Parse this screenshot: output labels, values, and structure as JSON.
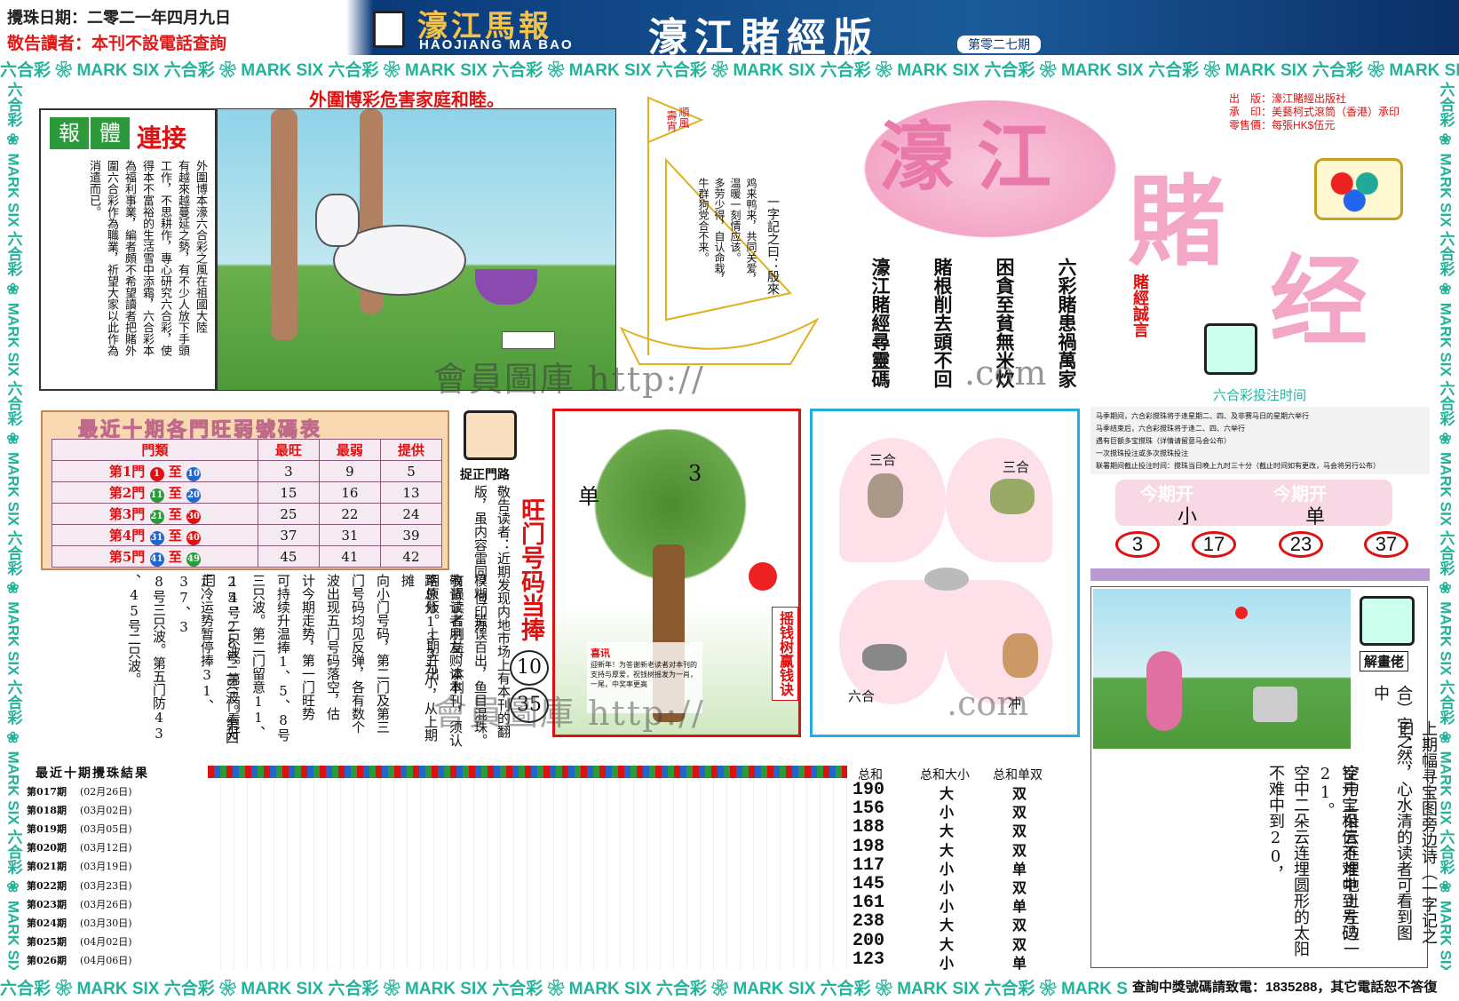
{
  "header": {
    "date_text": "攪珠日期：二零二一年四月九日",
    "notice": "敬告讀者：本刊不設電話查詢",
    "logo_title": "濠江馬報",
    "logo_sub": "HAOJIANG MA BAO",
    "edition_title": "濠江賭經版",
    "issue": "第零二七期"
  },
  "banner_text": "六合彩 ❀ MARK SIX 六合彩 ❀ MARK SIX 六合彩 ❀ MARK SIX 六合彩 ❀ MARK SIX 六合彩 ❀ MARK SIX 六合彩 ❀ MARK SIX 六合彩 ❀ MARK SIX 六合彩 ❀ MARK SIX 六合彩 ❀ MARK SIX 六合彩 ❀ MARK SIX",
  "top_slogan": "外圍博彩危害家庭和睦。",
  "lianjie": {
    "tag1": "報",
    "tag2": "體",
    "heading": "連接",
    "col1": "外圍博本濠六合彩之風在祖國大陸",
    "col2": "有越來越蔓延之勢，有不少人放下手頭",
    "col3": "工作，不思耕作，專心研究六合彩，使",
    "col4": "得本不富裕的生活雪中添霜，六合彩本",
    "col5": "為福利事業，編者頗不希望讀者把賭外",
    "col6": "圍六合彩作為職業，祈望大家以此作為",
    "col7": "消遣而已。"
  },
  "sail": {
    "flag": "順風",
    "flag2": "壽宵",
    "col1": "一字記之曰：殷來",
    "col2": "鸡来鸭来，共同关爱，",
    "col3": "温暖一刻情应该。",
    "col4": "多劳少得，自认命栽，",
    "col5": "牛群狗党合不来。"
  },
  "poem": {
    "c1": "六彩賭患禍萬家",
    "c2": "困貪至貧無米炊",
    "c3": "賭根削去頭不回",
    "c4": "濠江賭經尋靈碼"
  },
  "big_logo": {
    "char1": "濠",
    "char2": "江",
    "char3": "賭",
    "char4": "经",
    "motto": "賭經誠言"
  },
  "publisher": {
    "line1": "出　版：濠江賭經出版社",
    "line2": "承　印：美藝柯式滾筒（香港）承印",
    "line3": "零售價：每張HK$伍元"
  },
  "schedule": {
    "title": "六合彩投注时间",
    "items": [
      "马季期间，六合彩搅珠将于逢星期二、四、及非赛马日的星期六举行",
      "马季结束后，六合彩搅珠将于逢二、四、六举行",
      "遇有巨额多宝搅珠（详情请留意马会公布）",
      "一次搅珠投注或多次搅珠投注",
      "联署期间截止投注时间：搅珠当日晚上九时三十分（截止时间如有更改，马会将另行公布）"
    ]
  },
  "this_issue": {
    "label1": "今期开",
    "label2": "今期开",
    "v1": "小",
    "v2": "单",
    "nums": [
      "3",
      "17",
      "23",
      "37"
    ]
  },
  "men_table": {
    "title": "最近十期各門旺弱號碼表",
    "headers": [
      "門類",
      "最旺",
      "最弱",
      "提供"
    ],
    "rows": [
      {
        "name": "第1門",
        "a": "1",
        "b": "10",
        "hot": "3",
        "cold": "9",
        "give": "5"
      },
      {
        "name": "第2門",
        "a": "11",
        "b": "20",
        "hot": "15",
        "cold": "16",
        "give": "13"
      },
      {
        "name": "第3門",
        "a": "21",
        "b": "30",
        "hot": "25",
        "cold": "22",
        "give": "24"
      },
      {
        "name": "第4門",
        "a": "31",
        "b": "40",
        "hot": "37",
        "cold": "31",
        "give": "39"
      },
      {
        "name": "第5門",
        "a": "41",
        "b": "49",
        "hot": "45",
        "cold": "41",
        "give": "42"
      }
    ],
    "zhi": "至"
  },
  "zhuozheng": {
    "label": "捉正門路",
    "big": "旺门号码当捧",
    "n1": "10",
    "n2": "35"
  },
  "article": {
    "cols": [
      "敬告读者：近期发现内地市场上有本刊的翻版，虽内容雷同，但印办",
      "模糊，错误百出，鱼目混珠。有损读者利益，本刊",
      "敬请读者朋友购读本刊，须认明原版。上期开出",
      "路总分133为小，从上期摊",
      "向小门号码，第二门及第三",
      "门号码均见反弹，各有数个",
      "波出现五门号码落空，估",
      "计今期走势，第一门旺势",
      "可持续升温捧1、5、8号",
      "三只波。第二门留意11、",
      "14号二只波。第三门看好",
      "25、28号二只波。第四门",
      "走冷运势暂停捧31、37、3",
      "8号三只波。第五门防43",
      "、45号二只波。"
    ]
  },
  "tree": {
    "dan": "单",
    "num": "3",
    "vtext": "摇钱树赢钱诀",
    "box_title": "喜讯",
    "box_text": "迎新年！为答谢新老读者对本刊的支持与厚爱，祝钱树摇发为一肖，一尾，中奖率更高"
  },
  "zodiac": {
    "top_left": "三合",
    "top_right": "三合",
    "bottom_left": "六合",
    "bottom_right": "冲"
  },
  "jie": {
    "label": "解畫佬",
    "cols": [
      "上期幅寻宝图旁边诗（一字记之曰：",
      "合）字之然，心水清的读者可看到图中",
      "空中二朵云连埋地上左边一",
      "锭元宝相信不难中到号码21。",
      "空中二朵云连埋圆形的太阳",
      "不难中到20，"
    ]
  },
  "results": {
    "title": "最近十期攪珠結果",
    "col_sum": "总和",
    "col_size": "总和大小",
    "col_oe": "总和单双",
    "rows": [
      {
        "issue": "第017期",
        "date": "(02月26日)",
        "sum": "190",
        "size": "大",
        "oe": "双"
      },
      {
        "issue": "第018期",
        "date": "(03月02日)",
        "sum": "156",
        "size": "小",
        "oe": "双"
      },
      {
        "issue": "第019期",
        "date": "(03月05日)",
        "sum": "188",
        "size": "大",
        "oe": "双"
      },
      {
        "issue": "第020期",
        "date": "(03月12日)",
        "sum": "198",
        "size": "大",
        "oe": "双"
      },
      {
        "issue": "第021期",
        "date": "(03月19日)",
        "sum": "117",
        "size": "小",
        "oe": "单"
      },
      {
        "issue": "第022期",
        "date": "(03月23日)",
        "sum": "145",
        "size": "小",
        "oe": "双"
      },
      {
        "issue": "第023期",
        "date": "(03月26日)",
        "sum": "161",
        "size": "小",
        "oe": "单"
      },
      {
        "issue": "第024期",
        "date": "(03月30日)",
        "sum": "238",
        "size": "大",
        "oe": "双"
      },
      {
        "issue": "第025期",
        "date": "(04月02日)",
        "sum": "200",
        "size": "大",
        "oe": "双"
      },
      {
        "issue": "第026期",
        "date": "(04月06日)",
        "sum": "123",
        "size": "小",
        "oe": "单"
      }
    ]
  },
  "footer": {
    "text": "查詢中獎號碼請致電：1835288，其它電話恕不答復"
  },
  "watermark": {
    "line1": "會員圖庫 http://",
    "line2": ".com",
    "line3": "會員圖庫 http://",
    "line4": ".com"
  },
  "colors": {
    "teal": "#22b39a",
    "red": "#d11",
    "pink": "#f4a6c6",
    "navy": "#0c3a78",
    "purple": "#8a5a7a"
  }
}
